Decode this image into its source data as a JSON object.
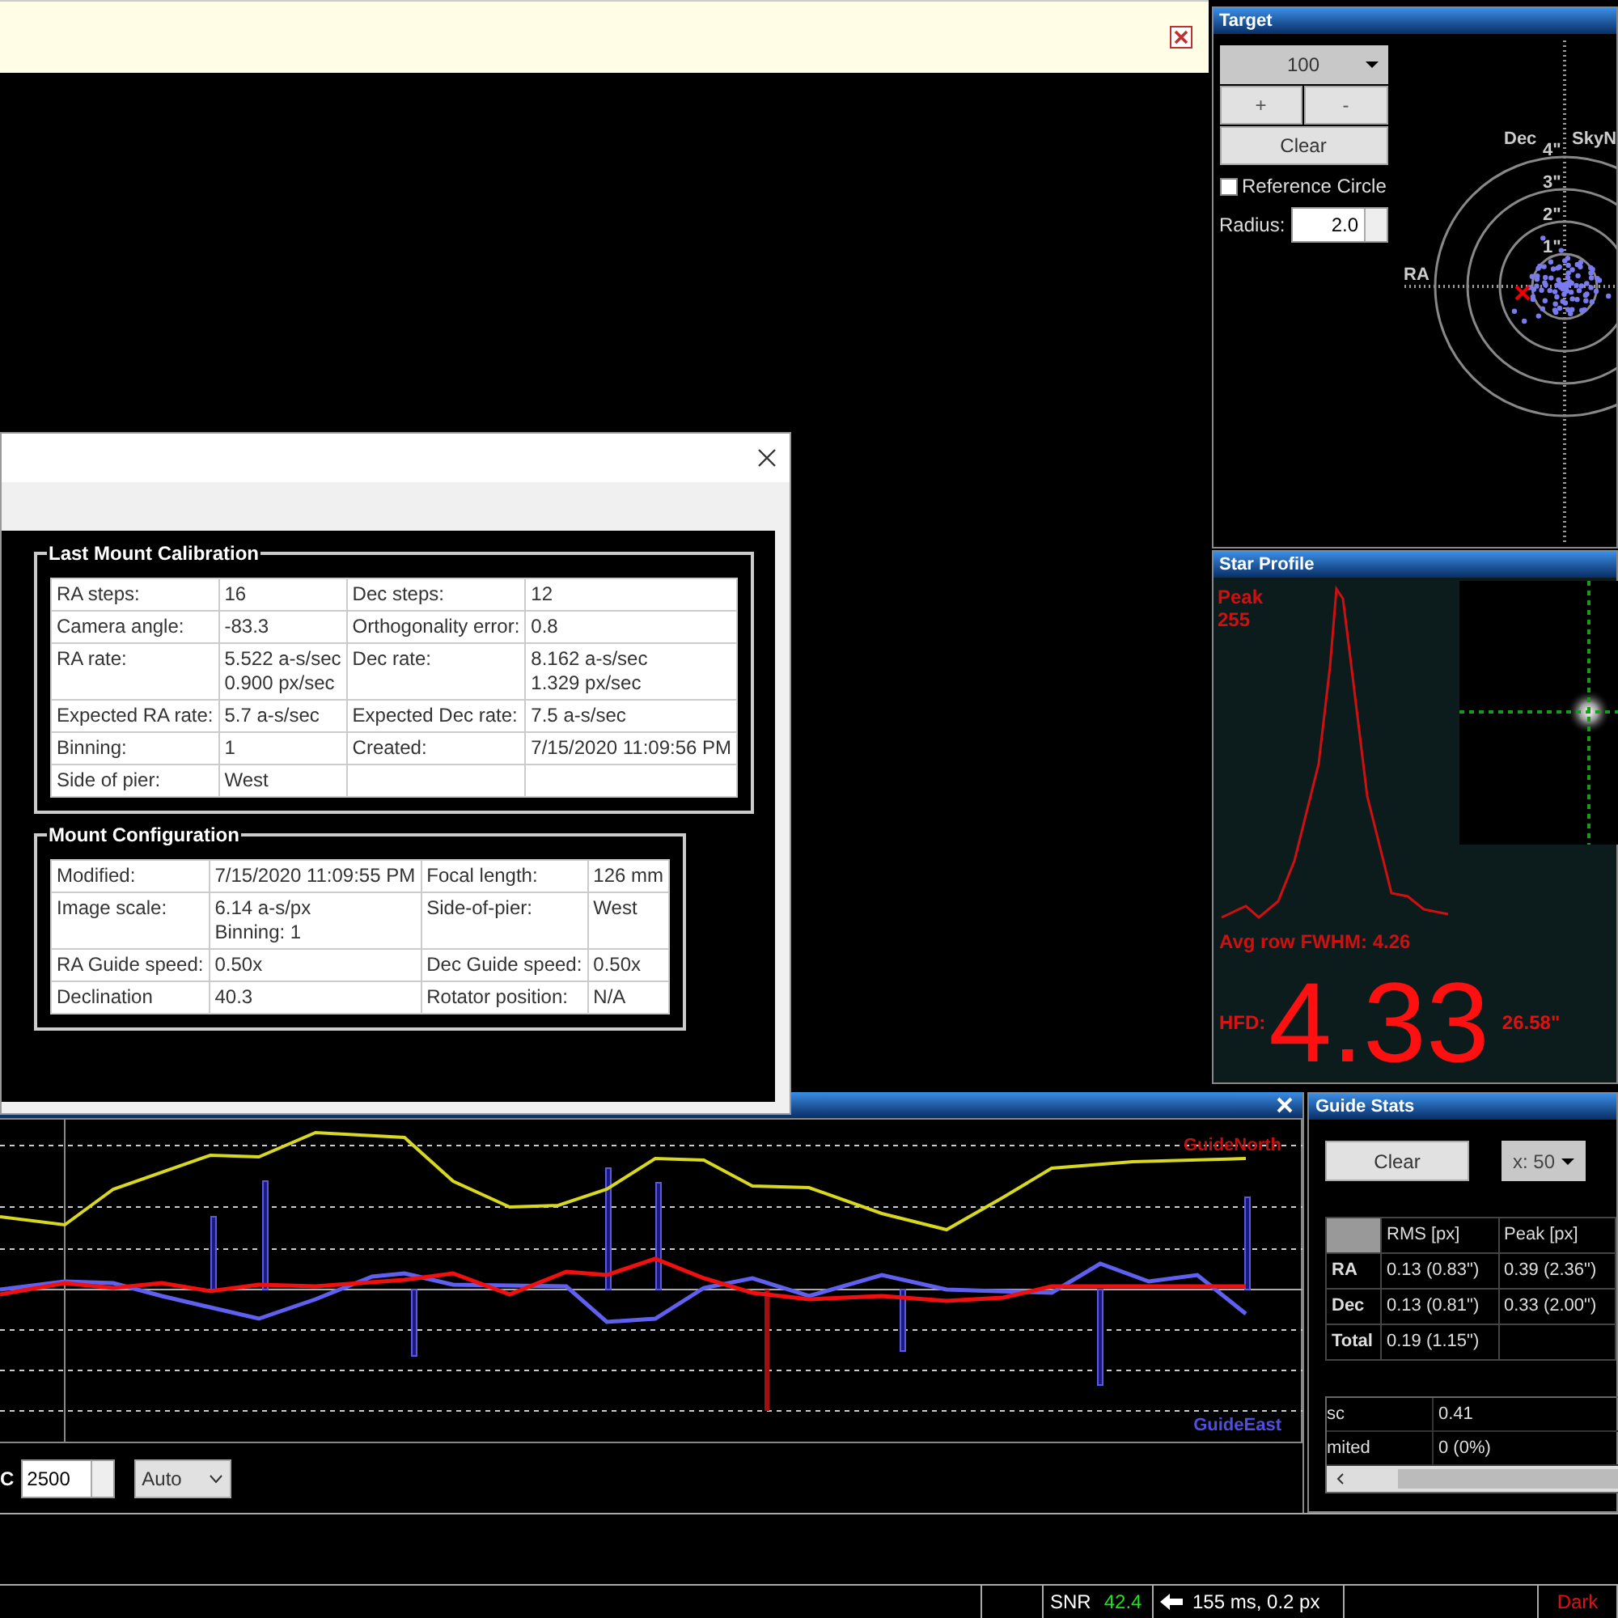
{
  "target": {
    "title": "Target",
    "zoom": "100",
    "buttons": [
      "+",
      "-"
    ],
    "clear": "Clear",
    "reference_circle": {
      "label": "Reference Circle",
      "checked": false
    },
    "radius": {
      "label": "Radius:",
      "value": "2.0"
    },
    "plot": {
      "dec_label": "Dec",
      "skyn_label": "SkyN",
      "ra_label": "RA",
      "ring_labels": [
        "4\"",
        "3\"",
        "2\"",
        "1\""
      ]
    }
  },
  "star_profile": {
    "title": "Star Profile",
    "peak_label": "Peak",
    "peak_value": "255",
    "fwhm": "Avg row FWHM: 4.26",
    "hfd_label": "HFD:",
    "hfd_value": "4.33",
    "hfd_arcsec": "26.58\""
  },
  "calibration_dialog": {
    "sections": [
      {
        "title": "Last Mount Calibration",
        "rows": [
          [
            "RA steps:",
            "16",
            "Dec steps:",
            "12"
          ],
          [
            "Camera angle:",
            "-83.3",
            "Orthogonality error:",
            "0.8"
          ],
          [
            "RA rate:",
            "5.522 a-s/sec\n0.900 px/sec",
            "Dec rate:",
            "8.162 a-s/sec\n1.329 px/sec"
          ],
          [
            "Expected RA rate:",
            "5.7 a-s/sec",
            "Expected Dec rate:",
            "7.5 a-s/sec"
          ],
          [
            "Binning:",
            "1",
            "Created:",
            "7/15/2020 11:09:56 PM"
          ],
          [
            "Side of pier:",
            "West",
            "",
            ""
          ]
        ]
      },
      {
        "title": "Mount Configuration",
        "rows": [
          [
            "Modified:",
            "7/15/2020 11:09:55 PM",
            "Focal length:",
            "126 mm"
          ],
          [
            "Image scale:",
            "6.14 a-s/px\nBinning: 1",
            "Side-of-pier:",
            "West"
          ],
          [
            "RA Guide speed:",
            "0.50x",
            "Dec Guide speed:",
            "0.50x"
          ],
          [
            "Declination",
            "40.3",
            "Rotator position:",
            "N/A"
          ]
        ]
      }
    ]
  },
  "graph": {
    "legend_north": "GuideNorth",
    "legend_east": "GuideEast",
    "scale_label": "C",
    "scale_value": "2500",
    "mode": "Auto"
  },
  "guide_stats": {
    "title": "Guide Stats",
    "clear": "Clear",
    "x_select": "x: 50",
    "columns": [
      "RMS [px]",
      "Peak [px]"
    ],
    "rows": [
      {
        "label": "RA",
        "rms": "0.13 (0.83\")",
        "peak": "0.39 (2.36\")"
      },
      {
        "label": "Dec",
        "rms": "0.13 (0.81\")",
        "peak": "0.33 (2.00\")"
      },
      {
        "label": "Total",
        "rms": "0.19 (1.15\")",
        "peak": ""
      }
    ],
    "details": [
      [
        "sc",
        "0.41"
      ],
      [
        "mited",
        "0 (0%)"
      ]
    ]
  },
  "status_bar": {
    "snr_label": "SNR",
    "snr_value": "42.4",
    "guide": "155 ms, 0.2 px",
    "dark": "Dark"
  }
}
